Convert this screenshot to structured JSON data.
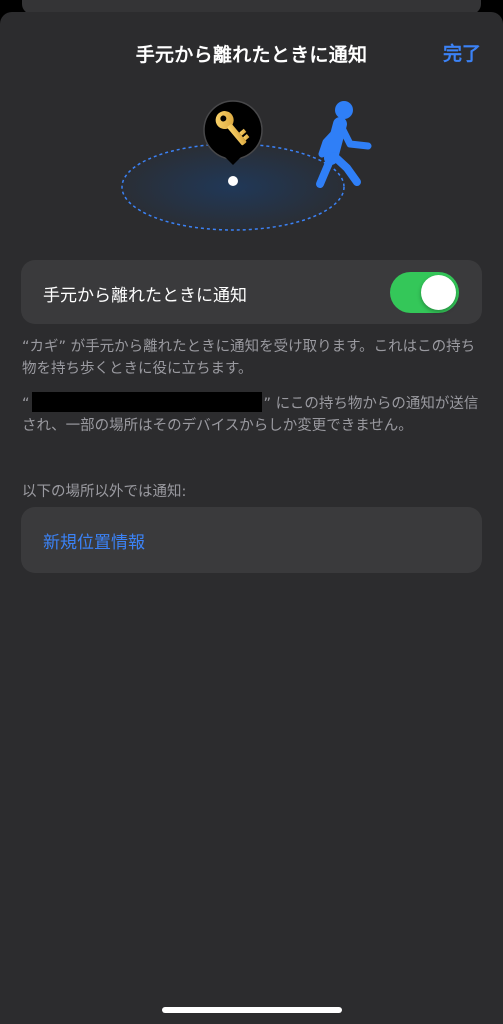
{
  "header": {
    "title": "手元から離れたときに通知",
    "done_label": "完了"
  },
  "illustration": {
    "key_icon": "key-icon",
    "walker_icon": "person-walking-icon",
    "accent": "#3b82f6"
  },
  "toggle_row": {
    "label": "手元から離れたときに通知",
    "enabled": true,
    "on_color": "#34c759"
  },
  "footnotes": {
    "item_description": "“カギ” が手元から離れたときに通知を受け取ります。これはこの持ち物を持ち歩くときに役に立ちます。",
    "device_prefix": "“",
    "device_suffix": "” にこの持ち物からの通知が送信され、一部の場所はそのデバイスからしか変更できません。"
  },
  "exceptions": {
    "header": "以下の場所以外では通知:",
    "new_location_label": "新規位置情報"
  }
}
